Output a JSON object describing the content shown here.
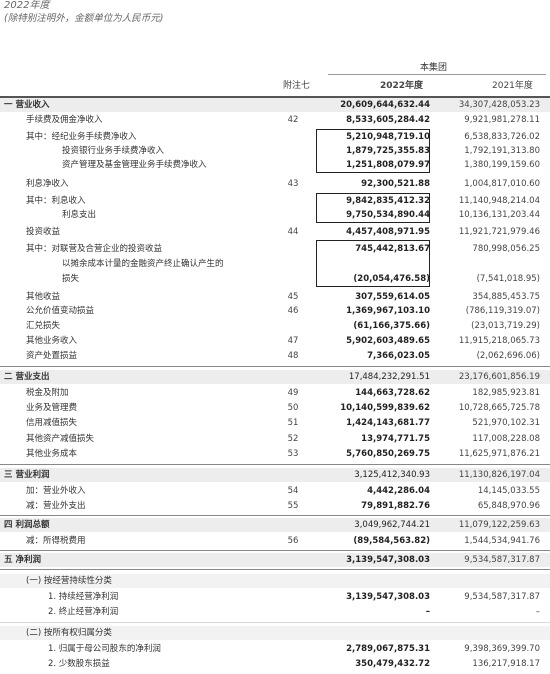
{
  "header": {
    "year": "2022年度",
    "note": "(除特别注明外，金额单位为人民币元)"
  },
  "group_label": "本集团",
  "columns": {
    "note": "附注七",
    "y2022": "2022年度",
    "y2021": "2021年度"
  },
  "rows": [
    {
      "label": "一  营业收入",
      "note": "",
      "v2022": "20,609,644,632.44",
      "v2021": "34,307,428,053.23"
    },
    {
      "label": "手续费及佣金净收入",
      "note": "42",
      "v2022": "8,533,605,284.42",
      "v2021": "9,921,981,278.11"
    },
    {
      "label": "其中：经纪业务手续费净收入",
      "note": "",
      "v2022": "5,210,948,719.10",
      "v2021": "6,538,833,726.02"
    },
    {
      "label": "投资银行业务手续费净收入",
      "note": "",
      "v2022": "1,879,725,355.83",
      "v2021": "1,792,191,313.80"
    },
    {
      "label": "资产管理及基金管理业务手续费净收入",
      "note": "",
      "v2022": "1,251,808,079.97",
      "v2021": "1,380,199,159.60"
    },
    {
      "label": "利息净收入",
      "note": "43",
      "v2022": "92,300,521.88",
      "v2021": "1,004,817,010.60"
    },
    {
      "label": "其中：利息收入",
      "note": "",
      "v2022": "9,842,835,412.32",
      "v2021": "11,140,948,214.04"
    },
    {
      "label": "利息支出",
      "note": "",
      "v2022": "9,750,534,890.44",
      "v2021": "10,136,131,203.44"
    },
    {
      "label": "投资收益",
      "note": "44",
      "v2022": "4,457,408,971.95",
      "v2021": "11,921,721,979.46"
    },
    {
      "label": "其中：对联营及合营企业的投资收益",
      "note": "",
      "v2022": "745,442,813.67",
      "v2021": "780,998,056.25"
    },
    {
      "label": "以摊余成本计量的金融资产终止确认产生的",
      "note": "",
      "v2022": "",
      "v2021": ""
    },
    {
      "label": "损失",
      "note": "",
      "v2022": "(20,054,476.58)",
      "v2021": "(7,541,018.95)"
    },
    {
      "label": "其他收益",
      "note": "45",
      "v2022": "307,559,614.05",
      "v2021": "354,885,453.75"
    },
    {
      "label": "公允价值变动损益",
      "note": "46",
      "v2022": "1,369,967,103.10",
      "v2021": "(786,119,319.07)"
    },
    {
      "label": "汇兑损失",
      "note": "",
      "v2022": "(61,166,375.66)",
      "v2021": "(23,013,719.29)"
    },
    {
      "label": "其他业务收入",
      "note": "47",
      "v2022": "5,902,603,489.65",
      "v2021": "11,915,218,065.73"
    },
    {
      "label": "资产处置损益",
      "note": "48",
      "v2022": "7,366,023.05",
      "v2021": "(2,062,696.06)"
    },
    {
      "label": "二  营业支出",
      "note": "",
      "v2022": "17,484,232,291.51",
      "v2021": "23,176,601,856.19"
    },
    {
      "label": "税金及附加",
      "note": "49",
      "v2022": "144,663,728.62",
      "v2021": "182,985,923.81"
    },
    {
      "label": "业务及管理费",
      "note": "50",
      "v2022": "10,140,599,839.62",
      "v2021": "10,728,665,725.78"
    },
    {
      "label": "信用减值损失",
      "note": "51",
      "v2022": "1,424,143,681.77",
      "v2021": "521,970,102.31"
    },
    {
      "label": "其他资产减值损失",
      "note": "52",
      "v2022": "13,974,771.75",
      "v2021": "117,008,228.08"
    },
    {
      "label": "其他业务成本",
      "note": "53",
      "v2022": "5,760,850,269.75",
      "v2021": "11,625,971,876.21"
    },
    {
      "label": "三  营业利润",
      "note": "",
      "v2022": "3,125,412,340.93",
      "v2021": "11,130,826,197.04"
    },
    {
      "label": "加：营业外收入",
      "note": "54",
      "v2022": "4,442,286.04",
      "v2021": "14,145,033.55"
    },
    {
      "label": "减：营业外支出",
      "note": "55",
      "v2022": "79,891,882.76",
      "v2021": "65,848,970.96"
    },
    {
      "label": "四  利润总额",
      "note": "",
      "v2022": "3,049,962,744.21",
      "v2021": "11,079,122,259.63"
    },
    {
      "label": "减：所得税费用",
      "note": "56",
      "v2022": "(89,584,563.82)",
      "v2021": "1,544,534,941.76"
    },
    {
      "label": "五  净利润",
      "note": "",
      "v2022": "3,139,547,308.03",
      "v2021": "9,534,587,317.87"
    },
    {
      "label": "(一) 按经营持续性分类",
      "note": "",
      "v2022": "",
      "v2021": ""
    },
    {
      "label": "1. 持续经营净利润",
      "note": "",
      "v2022": "3,139,547,308.03",
      "v2021": "9,534,587,317.87"
    },
    {
      "label": "2. 终止经营净利润",
      "note": "",
      "v2022": "–",
      "v2021": "–"
    },
    {
      "label": "(二) 按所有权归属分类",
      "note": "",
      "v2022": "",
      "v2021": ""
    },
    {
      "label": "1. 归属于母公司股东的净利润",
      "note": "",
      "v2022": "2,789,067,875.31",
      "v2021": "9,398,369,399.70"
    },
    {
      "label": "2. 少数股东损益",
      "note": "",
      "v2022": "350,479,432.72",
      "v2021": "136,217,918.17"
    }
  ]
}
